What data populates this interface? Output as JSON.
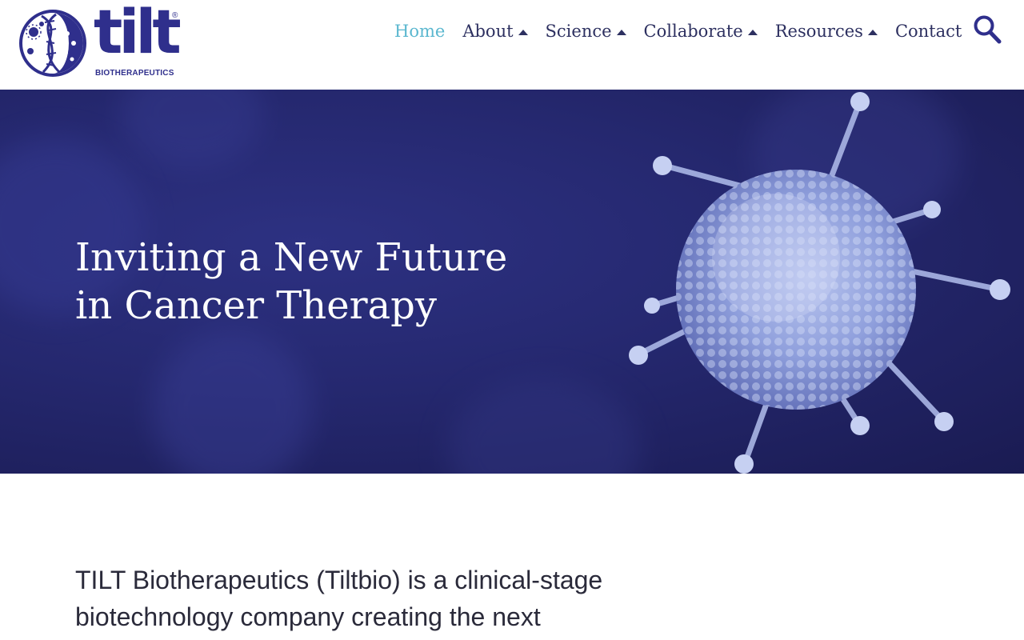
{
  "brand": {
    "name": "tilt",
    "registered": "®",
    "subtitle": "BIOTHERAPEUTICS"
  },
  "nav": {
    "items": [
      {
        "label": "Home",
        "active": true,
        "has_dropdown": false
      },
      {
        "label": "About",
        "active": false,
        "has_dropdown": true
      },
      {
        "label": "Science",
        "active": false,
        "has_dropdown": true
      },
      {
        "label": "Collaborate",
        "active": false,
        "has_dropdown": true
      },
      {
        "label": "Resources",
        "active": false,
        "has_dropdown": true
      },
      {
        "label": "Contact",
        "active": false,
        "has_dropdown": false
      }
    ],
    "search_icon": "search-icon",
    "dropdown_icon": "caret-up-icon"
  },
  "hero": {
    "title_line1": "Inviting a New Future",
    "title_line2": "in Cancer Therapy"
  },
  "intro": {
    "text": "TILT Biotherapeutics (Tiltbio) is a clinical-stage biotechnology company creating the next"
  },
  "colors": {
    "brand": "#2f2f8c",
    "nav_text": "#2d3060",
    "nav_active": "#5ab7cf",
    "hero_bg": "#25286f",
    "body_text": "#2a2a3a"
  }
}
